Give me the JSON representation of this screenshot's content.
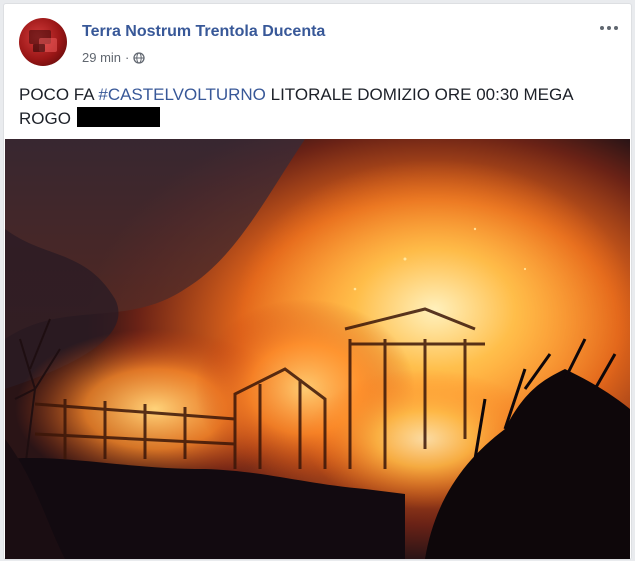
{
  "post": {
    "page_name": "Terra Nostrum Trentola Ducenta",
    "timestamp": "29 min",
    "separator": "·",
    "privacy_icon": "globe-icon",
    "more_icon": "more-options-icon",
    "text_before": "POCO FA ",
    "hashtag": "#CASTELVOLTURNO",
    "text_after": " LITORALE DOMIZIO ORE 00:30 MEGA ROGO",
    "redaction": "black-redaction-bar"
  },
  "photo": {
    "subject_icon": "fire-photo"
  },
  "colors": {
    "link": "#385898",
    "meta": "#616770",
    "text": "#1d2129",
    "card_border": "#dddfe2",
    "background": "#e9ebee"
  }
}
